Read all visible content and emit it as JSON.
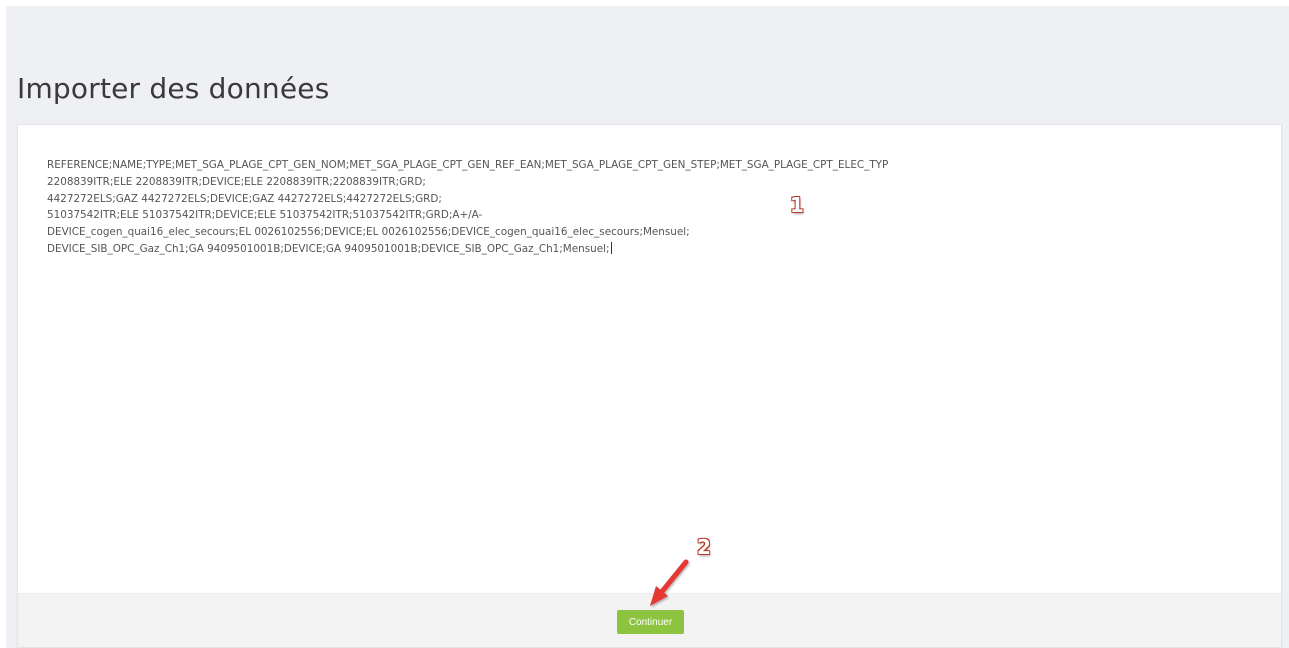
{
  "page": {
    "title": "Importer des données"
  },
  "import": {
    "lines": [
      "REFERENCE;NAME;TYPE;MET_SGA_PLAGE_CPT_GEN_NOM;MET_SGA_PLAGE_CPT_GEN_REF_EAN;MET_SGA_PLAGE_CPT_GEN_STEP;MET_SGA_PLAGE_CPT_ELEC_TYP",
      "2208839ITR;ELE 2208839ITR;DEVICE;ELE 2208839ITR;2208839ITR;GRD;",
      "4427272ELS;GAZ 4427272ELS;DEVICE;GAZ 4427272ELS;4427272ELS;GRD;",
      "51037542ITR;ELE 51037542ITR;DEVICE;ELE 51037542ITR;51037542ITR;GRD;A+/A-",
      "DEVICE_cogen_quai16_elec_secours;EL 0026102556;DEVICE;EL 0026102556;DEVICE_cogen_quai16_elec_secours;Mensuel;",
      "DEVICE_SIB_OPC_Gaz_Ch1;GA 9409501001B;DEVICE;GA 9409501001B;DEVICE_SIB_OPC_Gaz_Ch1;Mensuel;"
    ]
  },
  "footer": {
    "continue_label": "Continuer"
  },
  "annotations": {
    "marker_1": "1",
    "marker_2": "2",
    "arrow_color": "#e53935"
  },
  "colors": {
    "accent": "#8cc43f",
    "background": "#eff0f3"
  }
}
